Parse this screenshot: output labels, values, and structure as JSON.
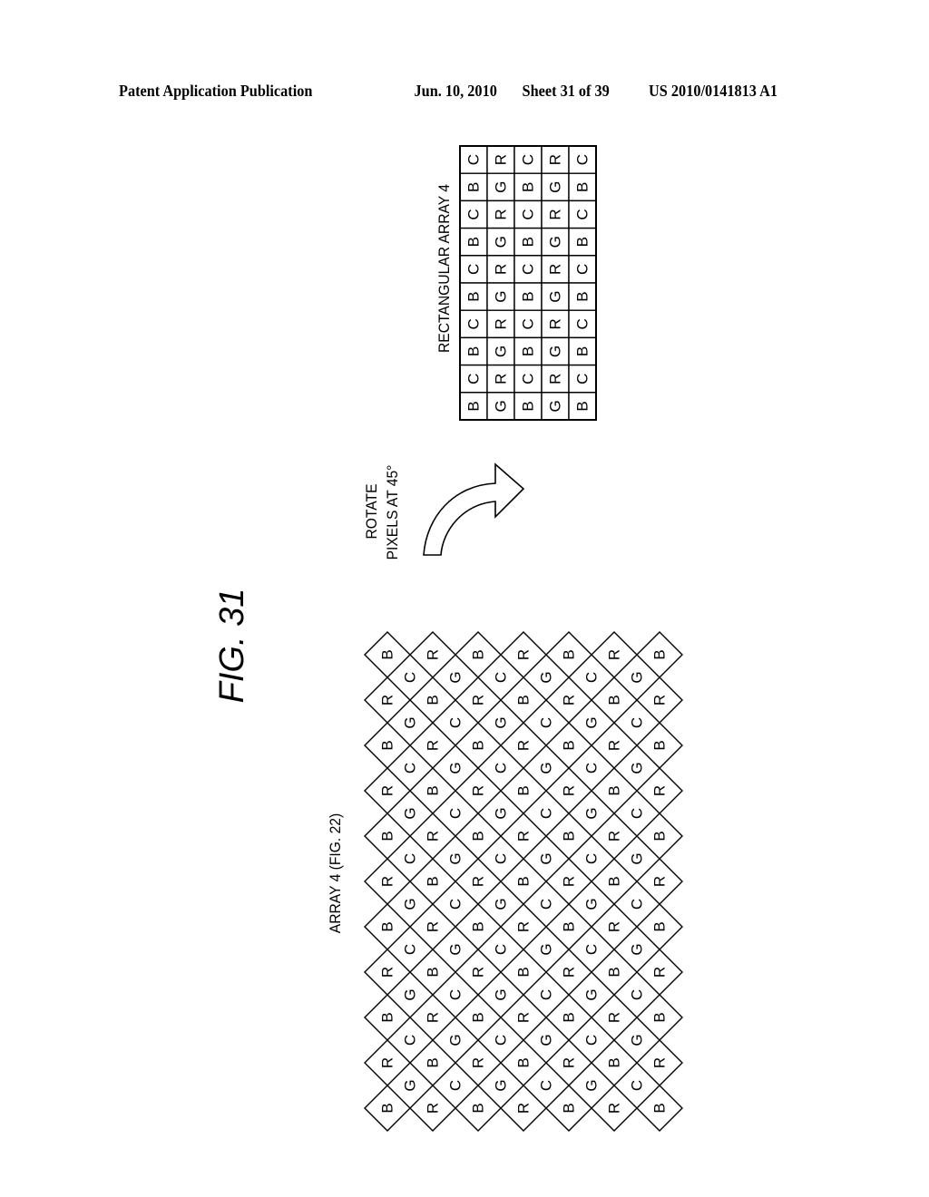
{
  "header": {
    "publication": "Patent Application Publication",
    "date": "Jun. 10, 2010",
    "sheet": "Sheet 31 of 39",
    "number": "US 2010/0141813 A1"
  },
  "figure": {
    "title": "FIG. 31",
    "diamond_label": "ARRAY 4 (FIG. 22)",
    "rect_label": "RECTANGULAR ARRAY 4",
    "arrow_label_line1": "ROTATE",
    "arrow_label_line2": "PIXELS AT 45°",
    "diamond_array": {
      "main_rows": [
        [
          "B",
          "R",
          "B",
          "R",
          "B",
          "R",
          "B"
        ],
        [
          "R",
          "B",
          "R",
          "B",
          "R",
          "B",
          "R"
        ],
        [
          "B",
          "R",
          "B",
          "R",
          "B",
          "R",
          "B"
        ],
        [
          "R",
          "B",
          "R",
          "B",
          "R",
          "B",
          "R"
        ],
        [
          "B",
          "R",
          "B",
          "R",
          "B",
          "R",
          "B"
        ],
        [
          "R",
          "B",
          "R",
          "B",
          "R",
          "B",
          "R"
        ],
        [
          "B",
          "R",
          "B",
          "R",
          "B",
          "R",
          "B"
        ],
        [
          "R",
          "B",
          "R",
          "B",
          "R",
          "B",
          "R"
        ],
        [
          "B",
          "R",
          "B",
          "R",
          "B",
          "R",
          "B"
        ],
        [
          "R",
          "B",
          "R",
          "B",
          "R",
          "B",
          "R"
        ],
        [
          "B",
          "R",
          "B",
          "R",
          "B",
          "R",
          "B"
        ]
      ],
      "inter_rows": [
        [
          "C",
          "G",
          "C",
          "G",
          "C",
          "G"
        ],
        [
          "G",
          "C",
          "G",
          "C",
          "G",
          "C"
        ],
        [
          "C",
          "G",
          "C",
          "G",
          "C",
          "G"
        ],
        [
          "G",
          "C",
          "G",
          "C",
          "G",
          "C"
        ],
        [
          "C",
          "G",
          "C",
          "G",
          "C",
          "G"
        ],
        [
          "G",
          "C",
          "G",
          "C",
          "G",
          "C"
        ],
        [
          "C",
          "G",
          "C",
          "G",
          "C",
          "G"
        ],
        [
          "G",
          "C",
          "G",
          "C",
          "G",
          "C"
        ],
        [
          "C",
          "G",
          "C",
          "G",
          "C",
          "G"
        ],
        [
          "G",
          "C",
          "G",
          "C",
          "G",
          "C"
        ]
      ]
    },
    "rect_array": [
      [
        "C",
        "R",
        "C",
        "R",
        "C"
      ],
      [
        "B",
        "G",
        "B",
        "G",
        "B"
      ],
      [
        "C",
        "R",
        "C",
        "R",
        "C"
      ],
      [
        "B",
        "G",
        "B",
        "G",
        "B"
      ],
      [
        "C",
        "R",
        "C",
        "R",
        "C"
      ],
      [
        "B",
        "G",
        "B",
        "G",
        "B"
      ],
      [
        "C",
        "R",
        "C",
        "R",
        "C"
      ],
      [
        "B",
        "G",
        "B",
        "G",
        "B"
      ],
      [
        "C",
        "R",
        "C",
        "R",
        "C"
      ],
      [
        "B",
        "G",
        "B",
        "G",
        "B"
      ]
    ]
  }
}
